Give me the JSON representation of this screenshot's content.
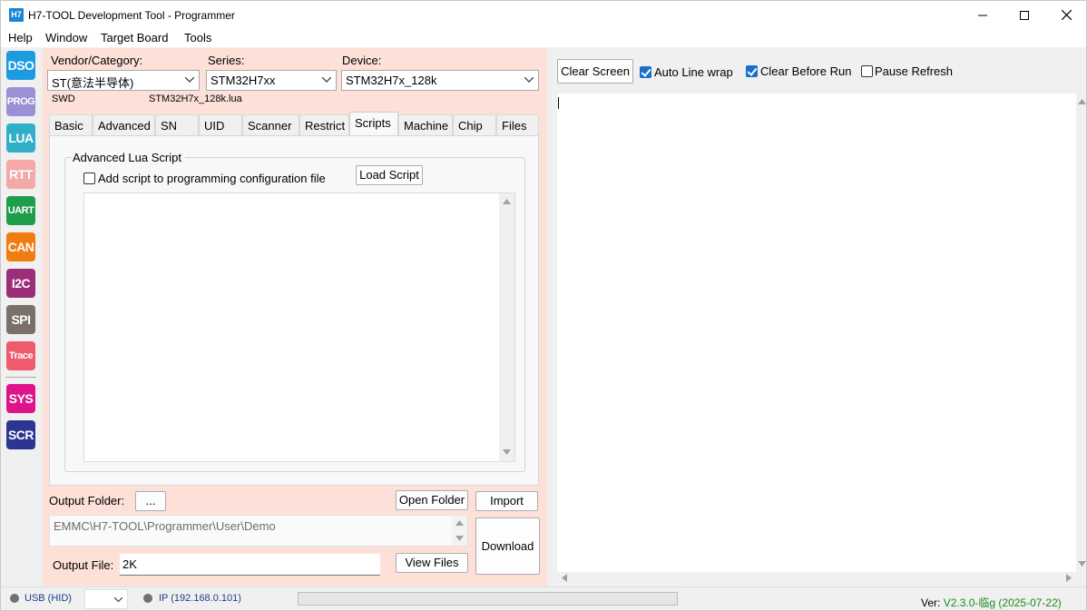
{
  "window": {
    "icon_text": "H7",
    "title": "H7-TOOL Development Tool - Programmer"
  },
  "menu": [
    "Help",
    "Window",
    "Target Board",
    "Tools"
  ],
  "toolbar": [
    {
      "label": "DSO",
      "color": "#1e9be0"
    },
    {
      "label": "PROG",
      "color": "#9c8fd6"
    },
    {
      "label": "LUA",
      "color": "#2fb0c8"
    },
    {
      "label": "RTT",
      "color": "#f4a8a8"
    },
    {
      "label": "UART",
      "color": "#1e9e4a"
    },
    {
      "label": "CAN",
      "color": "#f07d12"
    },
    {
      "label": "I2C",
      "color": "#9b2e78"
    },
    {
      "label": "SPI",
      "color": "#7a6f6a"
    },
    {
      "label": "Trace",
      "color": "#ee5a6e"
    },
    {
      "label": "SYS",
      "color": "#e0148a"
    },
    {
      "label": "SCR",
      "color": "#2c3592"
    }
  ],
  "left": {
    "vendor_label": "Vendor/Category:",
    "vendor_value": "ST(意法半导体)",
    "series_label": "Series:",
    "series_value": "STM32H7xx",
    "device_label": "Device:",
    "device_value": "STM32H7x_128k",
    "interface": "SWD",
    "lua_file": "STM32H7x_128k.lua",
    "tabs": [
      "Basic",
      "Advanced",
      "SN",
      "UID",
      "Scanner",
      "Restrict",
      "Scripts",
      "Machine",
      "Chip",
      "Files"
    ],
    "active_tab": "Scripts",
    "group_title": "Advanced Lua Script",
    "add_script_label": "Add script to programming configuration file",
    "add_script_checked": false,
    "load_script_button": "Load Script",
    "script_content": "",
    "output_folder_label": "Output Folder:",
    "browse_button": "...",
    "open_folder_button": "Open Folder",
    "import_button": "Import",
    "output_path": "EMMC\\H7-TOOL\\Programmer\\User\\Demo",
    "download_button": "Download",
    "output_file_label": "Output File:",
    "output_file_value": "2K",
    "view_files_button": "View Files"
  },
  "right": {
    "clear_screen_button": "Clear Screen",
    "auto_wrap_label": "Auto Line wrap",
    "auto_wrap_checked": true,
    "clear_before_run_label": "Clear Before Run",
    "clear_before_run_checked": true,
    "pause_refresh_label": "Pause Refresh",
    "pause_refresh_checked": false
  },
  "status": {
    "usb_label": "USB (HID)",
    "usb_dropdown_value": "",
    "ip_label": "IP (192.168.0.101)",
    "progress": 0,
    "ver_label": "Ver:",
    "ver_value": "V2.3.0-临g (2025-07-22)"
  }
}
